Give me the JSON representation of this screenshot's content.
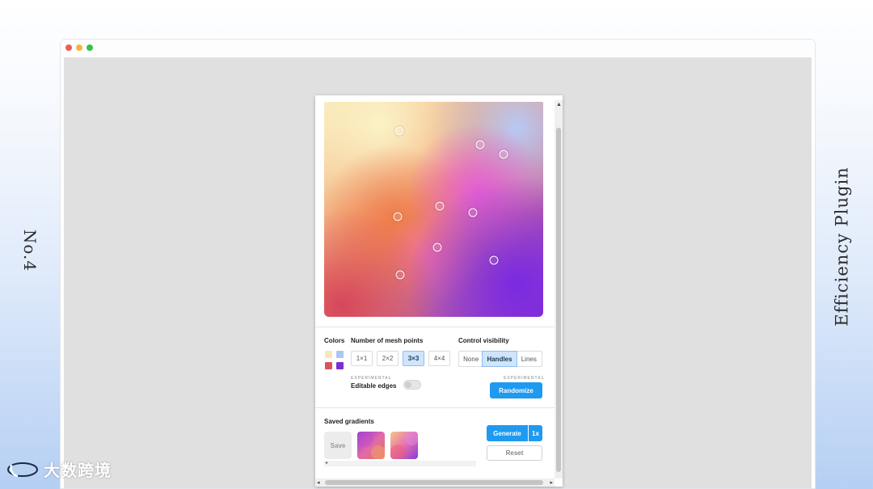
{
  "side_labels": {
    "left": "No.4",
    "right": "Efficiency Plugin"
  },
  "window": {
    "controls": [
      "close",
      "minimize",
      "maximize"
    ]
  },
  "plugin": {
    "colors_label": "Colors",
    "swatches": [
      "#f6e8b8",
      "#a9c8f2",
      "#d9545a",
      "#7b2fd2"
    ],
    "mesh_label": "Number of mesh points",
    "mesh_options": [
      "1×1",
      "2×2",
      "3×3",
      "4×4"
    ],
    "mesh_selected": "3×3",
    "visibility_label": "Control visibility",
    "visibility_options": [
      "None",
      "Handles",
      "Lines"
    ],
    "visibility_selected": "Handles",
    "experimental_left": "EXPERIMENTAL",
    "editable_edges_label": "Editable edges",
    "editable_edges_on": false,
    "experimental_right": "EXPERIMENTAL",
    "randomize_label": "Randomize",
    "saved_label": "Saved gradients",
    "save_label": "Save",
    "generate_label": "Generate",
    "generate_multiplier": "1x",
    "reset_label": "Reset",
    "accent_color": "#1e9af0"
  },
  "watermark": {
    "text": "大数跨境"
  }
}
